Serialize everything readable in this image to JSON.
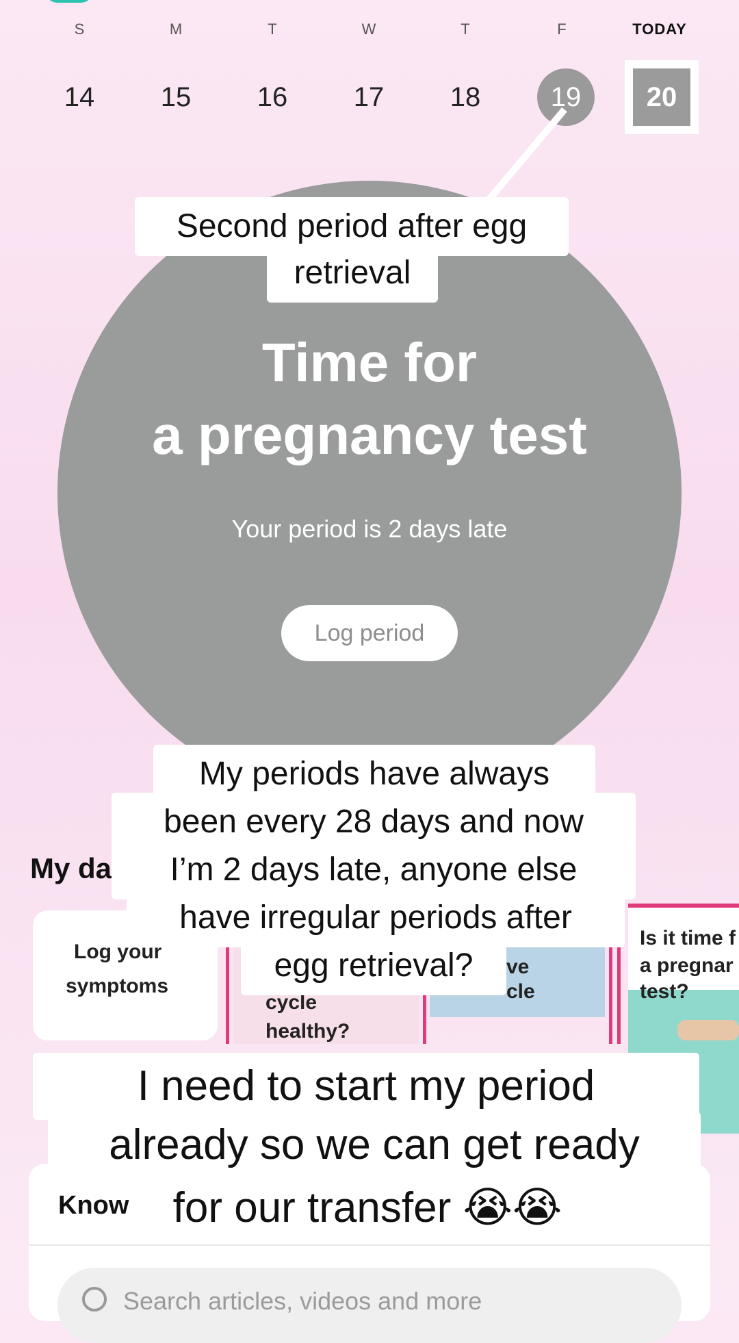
{
  "week": {
    "days": [
      {
        "letter": "S",
        "num": "14"
      },
      {
        "letter": "M",
        "num": "15"
      },
      {
        "letter": "T",
        "num": "16"
      },
      {
        "letter": "W",
        "num": "17"
      },
      {
        "letter": "T",
        "num": "18"
      },
      {
        "letter": "F",
        "num": "19"
      },
      {
        "letter": "TODAY",
        "num": "20"
      }
    ]
  },
  "circle": {
    "title_line1": "Time for",
    "title_line2": "a pregnancy test",
    "subtitle": "Your period is 2 days late",
    "button": "Log period"
  },
  "captions": {
    "top_line1": "Second period after egg",
    "top_line2": "retrieval",
    "middle_line1": "My periods have always",
    "middle_line2": "been every 28 days and now",
    "middle_line3": "I’m 2 days late, anyone else",
    "middle_line4": "have irregular periods after",
    "middle_line5": "egg retrieval?",
    "bottom_line1": "I need to start my period",
    "bottom_line2": "already so we can get ready",
    "bottom_line3": "for our transfer 😭😭"
  },
  "my_data": {
    "label": "My da",
    "cards": [
      {
        "text_line1": "Log your",
        "text_line2": "symptoms"
      },
      {
        "text_line1": "cycle",
        "text_line2": "healthy?"
      },
      {
        "text_line1": "ve",
        "text_line2": "cle"
      },
      {
        "text_line1": "Is it time f",
        "text_line2": "a pregnar",
        "text_line3": "test?"
      }
    ]
  },
  "know": {
    "label": "Know",
    "search_placeholder": "Search articles, videos and more"
  },
  "colors": {
    "accent_pink": "#e13a7a",
    "circle_gray": "#9a9b9b",
    "teal": "#2bc3b0",
    "card_blue": "#b9d4e6",
    "card_teal": "#8fd8cc"
  }
}
